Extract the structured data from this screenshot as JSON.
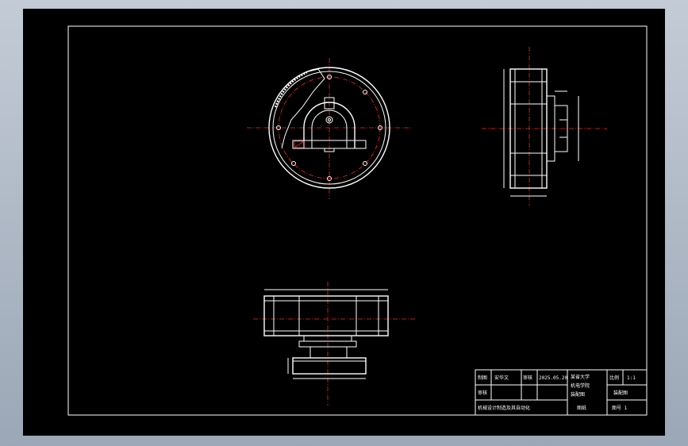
{
  "colors": {
    "background": "#a6b1c0",
    "sheet": "#000000",
    "line": "#ffffff",
    "centerline": "#ff2020",
    "accent": "#ff4040"
  },
  "title_block": {
    "r1_c1": "制图",
    "r1_c2": "安华文",
    "r1_c3": "审核",
    "r1_c4": "2025.05.20",
    "r1_c5a": "某省大学",
    "r1_c5b": "机电学院",
    "r1_c5c": "装配图",
    "r1_c6": "比例",
    "r1_c7": "1:1",
    "r2_c1": "审核",
    "r2_c6": "装配图",
    "r3_c1": "机械设计制造及其自动化",
    "r3_c4": "图纸",
    "r3_c6": "图号 1"
  }
}
